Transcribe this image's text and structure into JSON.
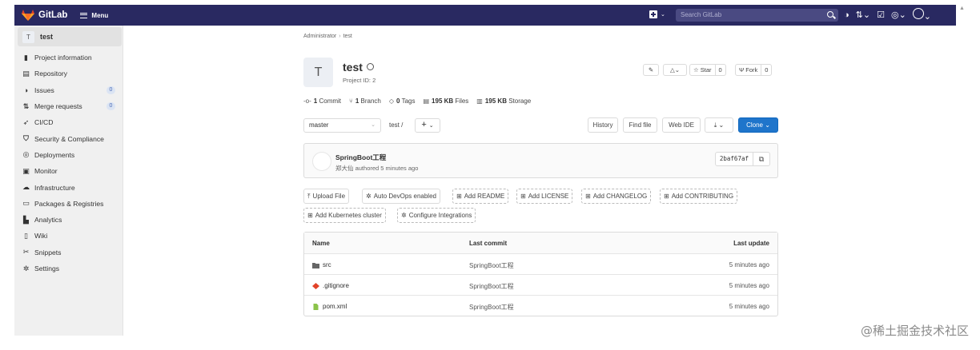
{
  "topbar": {
    "brand": "GitLab",
    "menu_label": "Menu",
    "search_placeholder": "Search GitLab"
  },
  "sidebar": {
    "project_avatar_letter": "T",
    "project_name": "test",
    "items": [
      {
        "label": "Project information",
        "icon": "info-icon"
      },
      {
        "label": "Repository",
        "icon": "document-icon"
      },
      {
        "label": "Issues",
        "icon": "issues-icon",
        "badge": "0"
      },
      {
        "label": "Merge requests",
        "icon": "merge-request-icon",
        "badge": "0"
      },
      {
        "label": "CI/CD",
        "icon": "rocket-icon"
      },
      {
        "label": "Security & Compliance",
        "icon": "shield-icon"
      },
      {
        "label": "Deployments",
        "icon": "deployments-icon"
      },
      {
        "label": "Monitor",
        "icon": "monitor-icon"
      },
      {
        "label": "Infrastructure",
        "icon": "cloud-icon"
      },
      {
        "label": "Packages & Registries",
        "icon": "package-icon"
      },
      {
        "label": "Analytics",
        "icon": "chart-icon"
      },
      {
        "label": "Wiki",
        "icon": "book-icon"
      },
      {
        "label": "Snippets",
        "icon": "scissors-icon"
      },
      {
        "label": "Settings",
        "icon": "gear-icon"
      }
    ]
  },
  "breadcrumb": {
    "parent": "Administrator",
    "sep": "›",
    "current": "test"
  },
  "project": {
    "avatar_letter": "T",
    "title": "test",
    "id_label": "Project ID: 2",
    "star_label": "Star",
    "star_count": "0",
    "fork_label": "Fork",
    "fork_count": "0"
  },
  "stats": {
    "commits_num": "1",
    "commits_label": "Commit",
    "branches_num": "1",
    "branches_label": "Branch",
    "tags_num": "0",
    "tags_label": "Tags",
    "files_size": "195 KB",
    "files_label": "Files",
    "storage_size": "195 KB",
    "storage_label": "Storage"
  },
  "toolbar": {
    "branch": "master",
    "path": "test",
    "path_sep": "/",
    "history": "History",
    "find_file": "Find file",
    "web_ide": "Web IDE",
    "clone": "Clone"
  },
  "commit": {
    "title": "SpringBoot工程",
    "author": "郑大仙",
    "meta": "authored 5 minutes ago",
    "sha": "2baf67af"
  },
  "actions": [
    {
      "label": "Upload File",
      "icon": "upload-icon",
      "style": "solid"
    },
    {
      "label": "Auto DevOps enabled",
      "icon": "gear-icon",
      "style": "solid"
    },
    {
      "label": "Add README",
      "icon": "plus-square-icon",
      "style": "dashed"
    },
    {
      "label": "Add LICENSE",
      "icon": "plus-square-icon",
      "style": "dashed"
    },
    {
      "label": "Add CHANGELOG",
      "icon": "plus-square-icon",
      "style": "dashed"
    },
    {
      "label": "Add CONTRIBUTING",
      "icon": "plus-square-icon",
      "style": "dashed"
    },
    {
      "label": "Add Kubernetes cluster",
      "icon": "plus-square-icon",
      "style": "dashed"
    },
    {
      "label": "Configure Integrations",
      "icon": "gear-icon",
      "style": "dashed"
    }
  ],
  "files_table": {
    "headers": [
      "Name",
      "Last commit",
      "Last update"
    ],
    "rows": [
      {
        "name": "src",
        "type": "folder",
        "commit": "SpringBoot工程",
        "updated": "5 minutes ago"
      },
      {
        "name": ".gitignore",
        "type": "git",
        "commit": "SpringBoot工程",
        "updated": "5 minutes ago"
      },
      {
        "name": "pom.xml",
        "type": "file",
        "commit": "SpringBoot工程",
        "updated": "5 minutes ago"
      }
    ]
  },
  "watermark": "@稀土掘金技术社区",
  "colors": {
    "topbar": "#292961",
    "primary": "#1f75cb",
    "sidebar": "#f0f0f0",
    "tanuki": "#e24329"
  }
}
